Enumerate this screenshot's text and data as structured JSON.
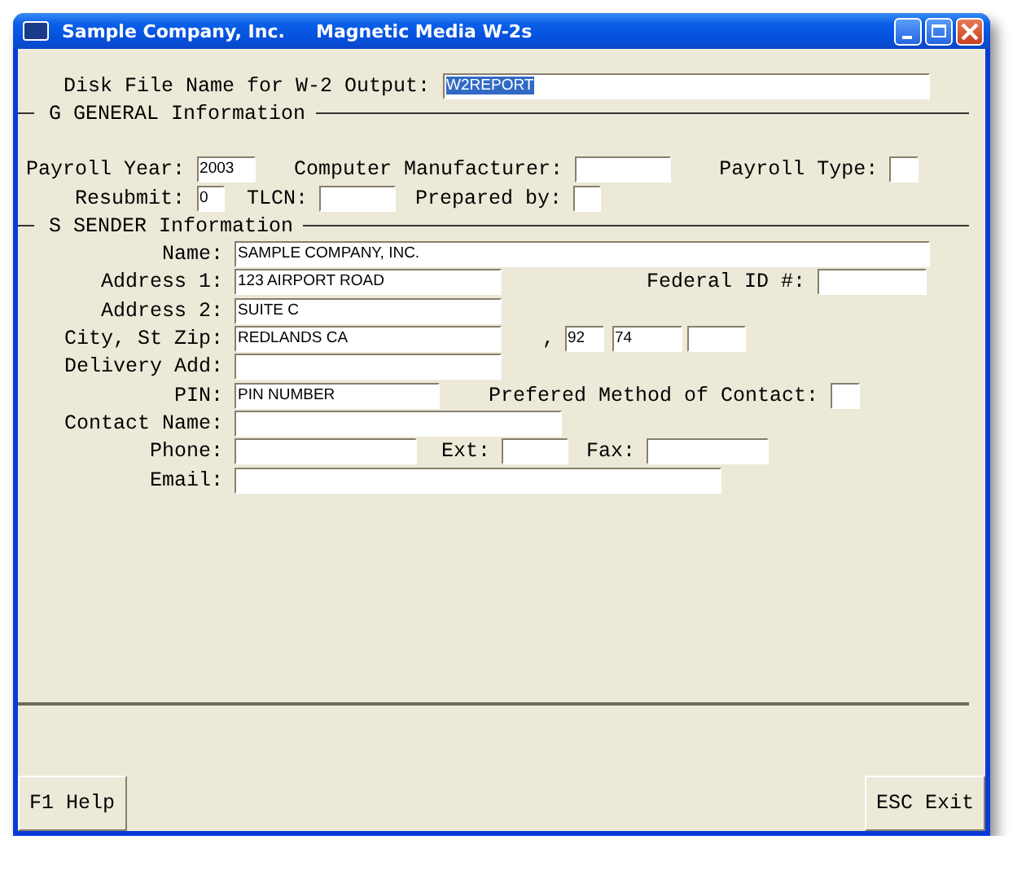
{
  "window": {
    "title": "Sample Company, Inc.",
    "caption": "Magnetic Media W-2s"
  },
  "output": {
    "label": "Disk File Name for W-2 Output:",
    "value": "W2REPORT",
    "text_selected": true
  },
  "sections": [
    {
      "title": "G GENERAL Information",
      "fields": [
        {
          "label": "Payroll Year:",
          "value": "2003"
        },
        {
          "label": "Computer Manufacturer:"
        },
        {
          "label": "Payroll Type:"
        },
        {
          "label": "Resubmit:",
          "value": "0"
        },
        {
          "label": "TLCN:"
        },
        {
          "label": "Prepared by:"
        }
      ]
    },
    {
      "title": "S SENDER Information",
      "fields": [
        {
          "label": "Name:",
          "value": "SAMPLE COMPANY, INC."
        },
        {
          "label": "Address 1:",
          "value": "123 AIRPORT ROAD"
        },
        {
          "label": "Federal ID #:"
        },
        {
          "label": "Address 2:",
          "value": "SUITE C"
        },
        {
          "label": "City, St Zip:",
          "value": "REDLANDS CA"
        },
        {
          "kind": "separator",
          "text": ","
        },
        {
          "value": "92"
        },
        {
          "value": "74"
        },
        {
          "kind": "field"
        },
        {
          "label": "Delivery Add:"
        },
        {
          "label": "PIN:",
          "value": "PIN NUMBER"
        },
        {
          "label": "Prefered Method of Contact:"
        },
        {
          "label": "Contact Name:"
        },
        {
          "label": "Phone:"
        },
        {
          "label": "Ext:"
        },
        {
          "label": "Fax:"
        },
        {
          "label": "Email:"
        }
      ]
    }
  ],
  "buttons": [
    "F1 Help",
    "ESC Exit"
  ]
}
